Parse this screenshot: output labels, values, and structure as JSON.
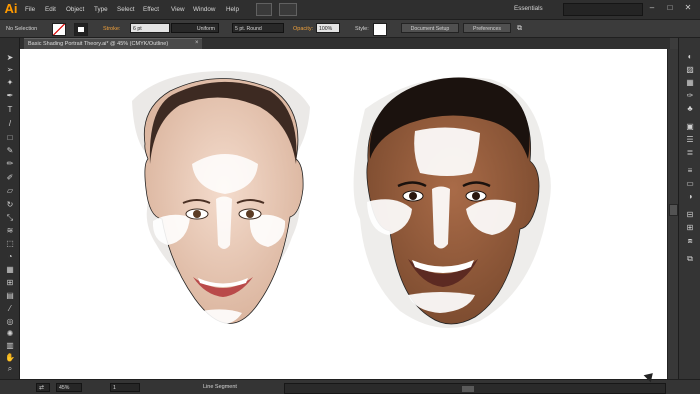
{
  "app": {
    "logo": "Ai",
    "workspace": "Essentials"
  },
  "menu": [
    "File",
    "Edit",
    "Object",
    "Type",
    "Select",
    "Effect",
    "View",
    "Window",
    "Help"
  ],
  "control": {
    "selection_status": "No Selection",
    "stroke_label": "Stroke:",
    "stroke_weight": "6 pt",
    "profile": "Uniform",
    "brush": "5 pt. Round",
    "opacity_label": "Opacity:",
    "opacity_value": "100%",
    "style_label": "Style:",
    "document_setup": "Document Setup",
    "preferences": "Preferences"
  },
  "document": {
    "tab_title": "Basic Shading Portrait Theory.ai* @ 45% (CMYK/Outline)",
    "close_symbol": "×"
  },
  "status": {
    "zoom": "45%",
    "artboard": "1",
    "tool_name": "Line Segment"
  },
  "colors": {
    "accent_orange": "#f0a13c",
    "chrome_dark": "#2f2f2f",
    "highlight_white": "#ffffff"
  },
  "icons": {
    "tools": [
      "selection-icon",
      "direct-selection-icon",
      "magic-wand-icon",
      "pen-icon",
      "type-icon",
      "line-segment-icon",
      "rectangle-icon",
      "paintbrush-icon",
      "pencil-icon",
      "blob-brush-icon",
      "eraser-icon",
      "rotate-icon",
      "scale-icon",
      "width-icon",
      "free-transform-icon",
      "shape-builder-icon",
      "perspective-grid-icon",
      "mesh-icon",
      "gradient-icon",
      "eyedropper-icon",
      "blend-icon",
      "symbol-sprayer-icon",
      "column-graph-icon",
      "artboard-icon",
      "slice-icon",
      "hand-icon",
      "zoom-icon",
      "fill-stroke-icon",
      "drawing-mode-icon",
      "screen-mode-icon"
    ],
    "panels": [
      "color-icon",
      "color-guide-icon",
      "swatches-icon",
      "brushes-icon",
      "symbols-icon",
      "graphic-styles-icon",
      "appearance-icon",
      "layers-icon",
      "stroke-icon",
      "gradient-panel-icon",
      "transparency-icon",
      "align-icon",
      "transform-icon",
      "pathfinder-icon",
      "artboards-panel-icon"
    ]
  }
}
